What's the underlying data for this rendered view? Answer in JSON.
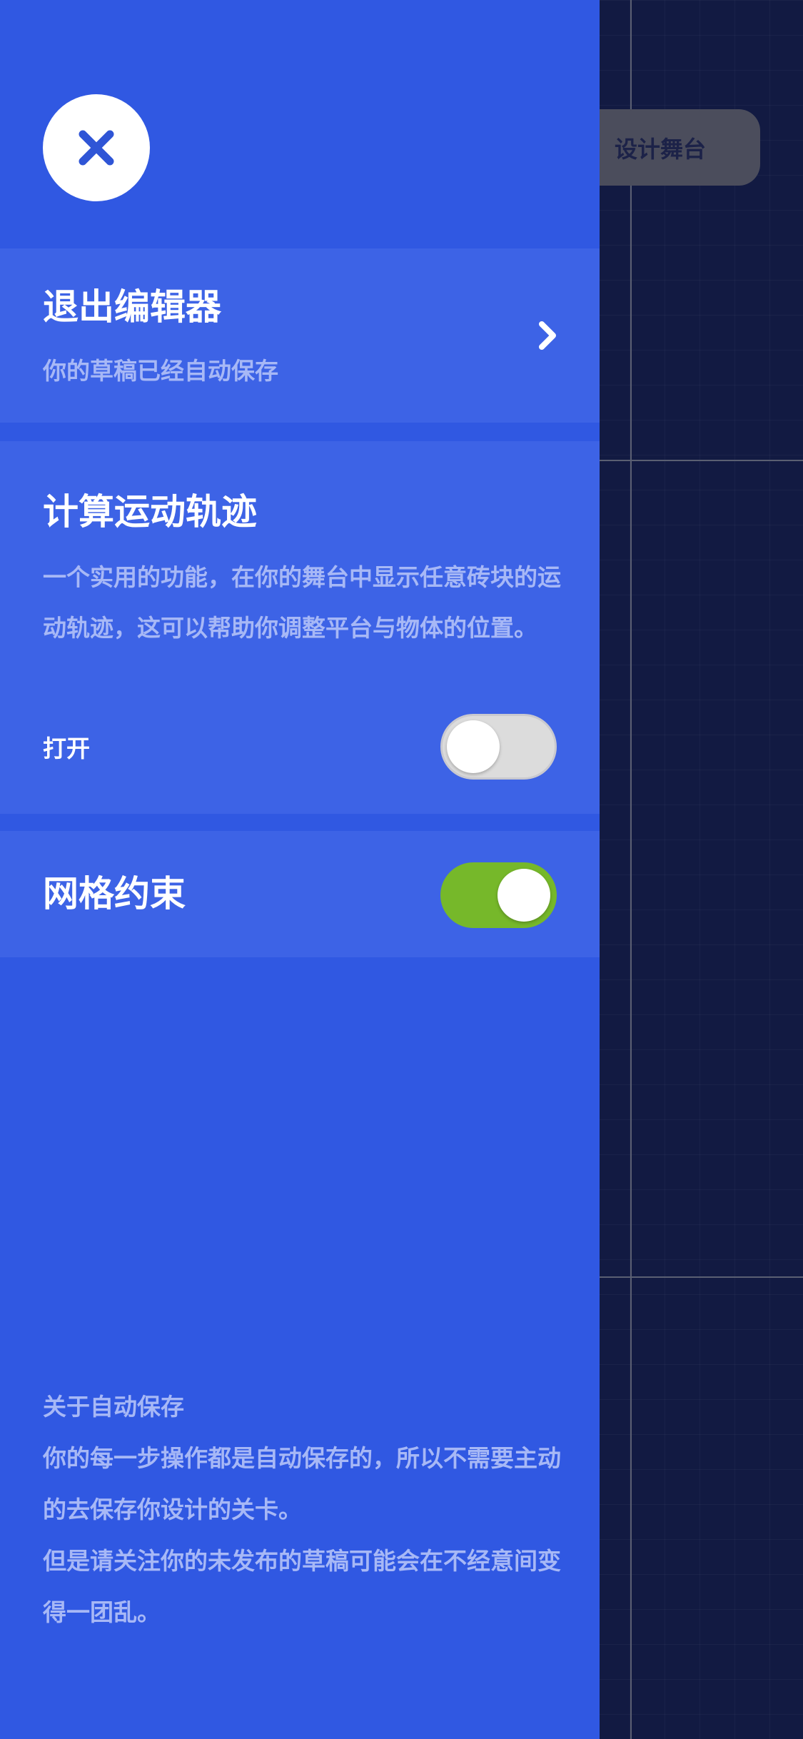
{
  "stage": {
    "design_stage_button": "设计舞台"
  },
  "drawer": {
    "close_icon": "close-icon",
    "exit_editor": {
      "title": "退出编辑器",
      "subtitle": "你的草稿已经自动保存",
      "icon": "chevron-right-icon"
    },
    "trajectory": {
      "title": "计算运动轨迹",
      "description": "一个实用的功能，在你的舞台中显示任意砖块的运动轨迹，这可以帮助你调整平台与物体的位置。",
      "toggle_label": "打开",
      "toggle_on": false
    },
    "grid_constraint": {
      "title": "网格约束",
      "toggle_on": true
    },
    "autosave_note": {
      "heading": "关于自动保存",
      "paragraph1": "你的每一步操作都是自动保存的，所以不需要主动的去保存你设计的关卡。",
      "paragraph2": "但是请关注你的未发布的草稿可能会在不经意间变得一团乱。"
    }
  },
  "colors": {
    "drawer_bg": "#3058e2",
    "card_bg": "#3d63e6",
    "stage_bg": "#121a42",
    "toggle_on": "#76b82a",
    "toggle_off": "#dcdcdc",
    "muted_text": "#a7b8f6"
  }
}
